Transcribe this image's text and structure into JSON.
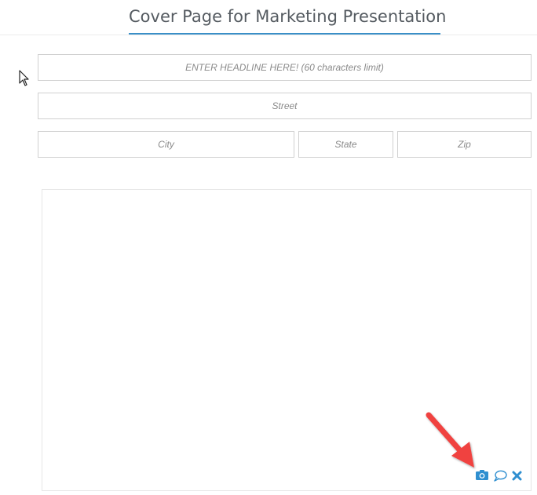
{
  "page": {
    "title": "Cover Page for Marketing Presentation"
  },
  "form": {
    "headline_placeholder": "ENTER HEADLINE HERE! (60 characters limit)",
    "street_placeholder": "Street",
    "city_placeholder": "City",
    "state_placeholder": "State",
    "zip_placeholder": "Zip"
  },
  "image_tools": {
    "camera_icon": "camera-icon",
    "comment_icon": "comment-icon",
    "close_icon": "close-icon",
    "accent_color": "#2f8fd0"
  },
  "annotation": {
    "arrow_color": "#f0423f"
  }
}
